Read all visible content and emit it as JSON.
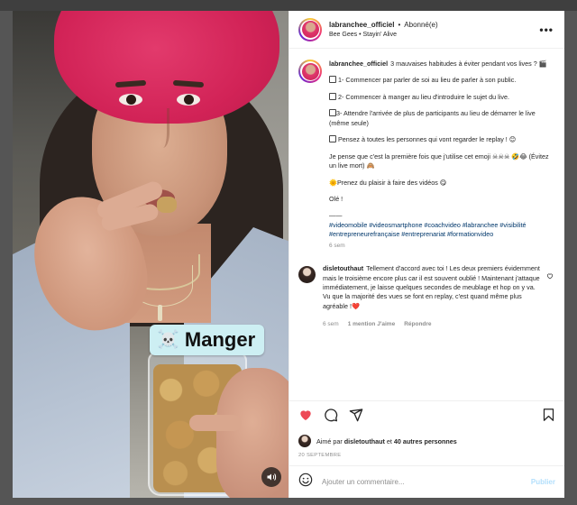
{
  "colors": {
    "beret": "#d22357",
    "link": "#00376b",
    "like_red": "#ed4956",
    "publish_disabled": "#b2dffc",
    "muted_text": "#8e8e8e",
    "sticker_bg": "#cdeff3"
  },
  "media": {
    "sticker_icon": "☠️",
    "sticker_text": "Manger",
    "mute_icon": "speaker-icon"
  },
  "header": {
    "username": "labranchee_officiel",
    "separator": "•",
    "follow_status": "Abonné(e)",
    "music": "Bee Gees • Stayin' Alive"
  },
  "caption": {
    "username": "labranchee_officiel",
    "intro": "3 mauvaises habitudes à éviter pendant vos lives ? 🎬",
    "habit_1": "1- Commencer par parler de soi au lieu de parler à son public.",
    "habit_2": "2- Commencer à manger au lieu d'introduire le sujet du live.",
    "habit_3": "3- Attendre l'arrivée de plus de participants au lieu de démarrer le live (même seule)",
    "replay_note": "Pensez à toutes les personnes qui vont regarder le replay ! 😊",
    "emoji_note": "Je pense que c'est la première fois que j'utilise cet emoji ☠☠☠ 🤣😂 (Évitez un live mort) 🙈",
    "pleasure": "🌞Prenez du plaisir à faire des vidéos 😋",
    "ole": "Olé !",
    "dashes": "——",
    "hashtags": "#videomobile #videosmartphone #coachvideo #labranchee #visibilité #entrepreneurefrançaise #entreprenariat #formationvideo",
    "time": "6 sem"
  },
  "comment": {
    "username": "disletouthaut",
    "text": "Tellement d'accord avec toi ! Les deux premiers évidemment mais le troisième encore plus car il est souvent oublié ! Maintenant j'attaque immédiatement, je laisse quelques secondes de meublage et hop on y va. Vu que la majorité des vues se font en replay, c'est quand même plus agréable !❤️",
    "time": "6 sem",
    "likes": "1 mention J'aime",
    "reply": "Répondre"
  },
  "likes": {
    "prefix": "Aimé par",
    "user": "disletouthaut",
    "middle": "et",
    "others": "40 autres personnes"
  },
  "date": "20 SEPTEMBRE",
  "add_comment": {
    "placeholder": "Ajouter un commentaire...",
    "publish": "Publier"
  },
  "icons": [
    "heart-icon",
    "comment-icon",
    "share-icon",
    "bookmark-icon",
    "emoji-icon",
    "more-icon",
    "speaker-icon"
  ]
}
